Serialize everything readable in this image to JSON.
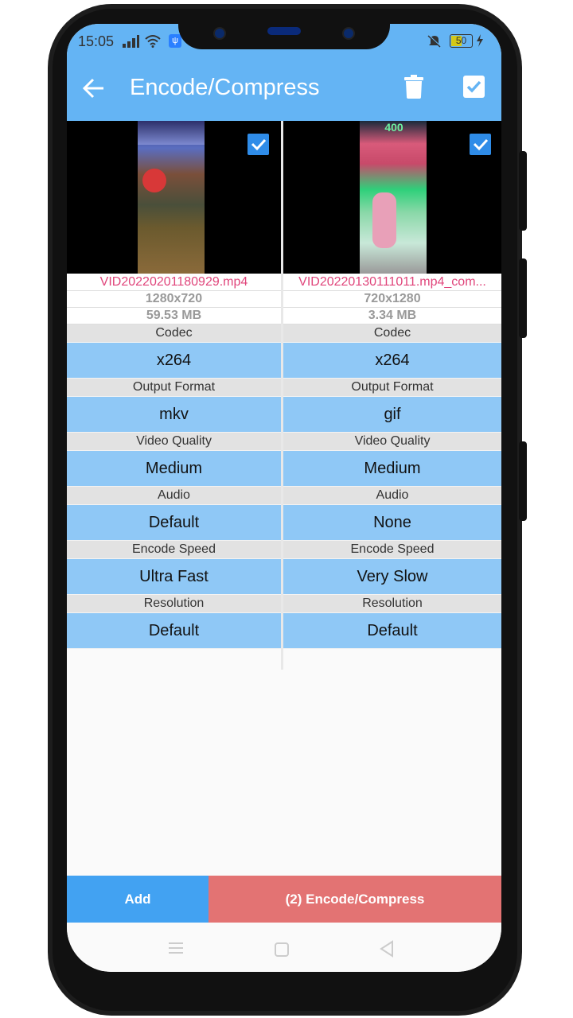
{
  "status_bar": {
    "time": "15:05",
    "battery": "50",
    "icons": [
      "signal-icon",
      "wifi-icon",
      "usb-icon",
      "mute-icon",
      "battery-icon",
      "charging-icon"
    ]
  },
  "app_bar": {
    "title": "Encode/Compress",
    "back_icon": "arrow-left-icon",
    "delete_icon": "trash-icon",
    "select_all_icon": "checkbox-checked-icon"
  },
  "videos": [
    {
      "filename": "VID20220201180929.mp4",
      "resolution": "1280x720",
      "size": "59.53 MB",
      "selected": true,
      "settings": [
        {
          "label": "Codec",
          "value": "x264"
        },
        {
          "label": "Output Format",
          "value": "mkv"
        },
        {
          "label": "Video Quality",
          "value": "Medium"
        },
        {
          "label": "Audio",
          "value": "Default"
        },
        {
          "label": "Encode Speed",
          "value": "Ultra Fast"
        },
        {
          "label": "Resolution",
          "value": "Default"
        }
      ]
    },
    {
      "filename": "VID20220130111011.mp4_com...",
      "resolution": "720x1280",
      "size": "3.34 MB",
      "selected": true,
      "settings": [
        {
          "label": "Codec",
          "value": "x264"
        },
        {
          "label": "Output Format",
          "value": "gif"
        },
        {
          "label": "Video Quality",
          "value": "Medium"
        },
        {
          "label": "Audio",
          "value": "None"
        },
        {
          "label": "Encode Speed",
          "value": "Very Slow"
        },
        {
          "label": "Resolution",
          "value": "Default"
        }
      ]
    }
  ],
  "bottom_bar": {
    "add_label": "Add",
    "encode_label": "(2) Encode/Compress"
  },
  "colors": {
    "primary": "#64b4f4",
    "add_button": "#42a2f2",
    "encode_button": "#e37373",
    "value_cell": "#8fc8f6",
    "filename": "#e0457b"
  }
}
